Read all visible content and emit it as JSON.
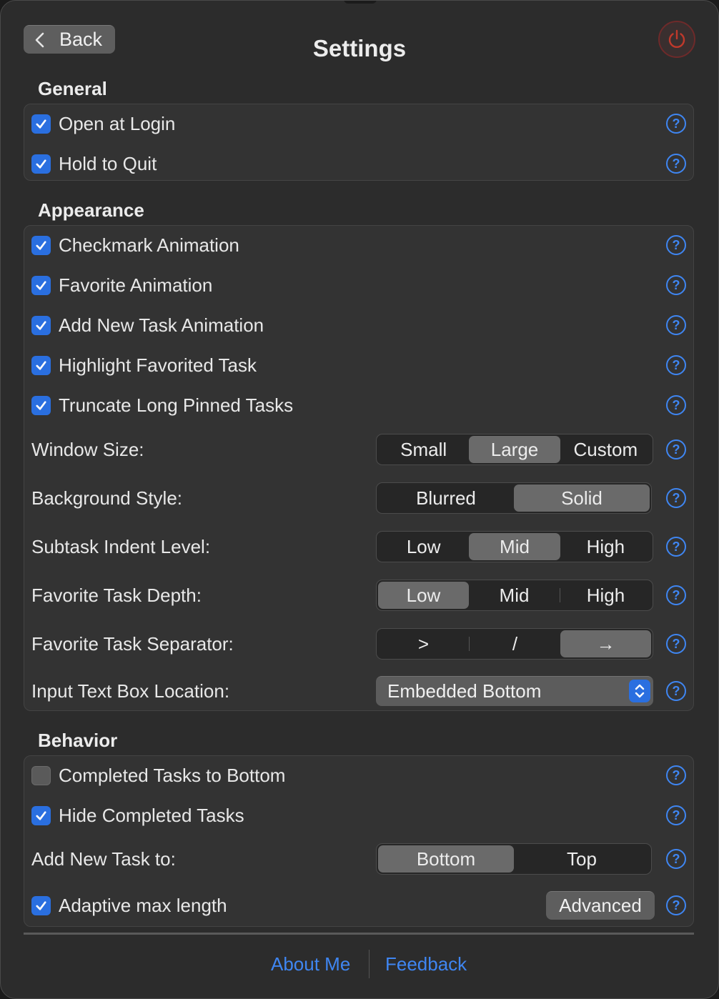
{
  "header": {
    "back_label": "Back",
    "title": "Settings",
    "back_icon": "chevron-left-icon",
    "power_icon": "power-icon",
    "power_color": "#c0392b"
  },
  "general": {
    "heading": "General",
    "items": [
      {
        "label": "Open at Login",
        "checked": true
      },
      {
        "label": "Hold to Quit",
        "checked": true
      }
    ]
  },
  "appearance": {
    "heading": "Appearance",
    "items": [
      {
        "label": "Checkmark Animation",
        "checked": true
      },
      {
        "label": "Favorite Animation",
        "checked": true
      },
      {
        "label": "Add New Task Animation",
        "checked": true
      },
      {
        "label": "Highlight Favorited Task",
        "checked": true
      },
      {
        "label": "Truncate Long Pinned Tasks",
        "checked": true
      }
    ],
    "window_size": {
      "label": "Window Size:",
      "options": [
        "Small",
        "Large",
        "Custom"
      ],
      "selected": "Large"
    },
    "background_style": {
      "label": "Background Style:",
      "options": [
        "Blurred",
        "Solid"
      ],
      "selected": "Solid"
    },
    "subtask_indent": {
      "label": "Subtask Indent Level:",
      "options": [
        "Low",
        "Mid",
        "High"
      ],
      "selected": "Mid"
    },
    "favorite_depth": {
      "label": "Favorite Task Depth:",
      "options": [
        "Low",
        "Mid",
        "High"
      ],
      "selected": "Low"
    },
    "favorite_separator": {
      "label": "Favorite Task Separator:",
      "options": [
        ">",
        "/",
        "→"
      ],
      "selected": "→"
    },
    "input_location": {
      "label": "Input Text Box Location:",
      "value": "Embedded Bottom"
    }
  },
  "behavior": {
    "heading": "Behavior",
    "items": [
      {
        "label": "Completed Tasks to Bottom",
        "checked": false
      },
      {
        "label": "Hide Completed Tasks",
        "checked": true
      }
    ],
    "add_new_task": {
      "label": "Add New Task to:",
      "options": [
        "Bottom",
        "Top"
      ],
      "selected": "Bottom"
    },
    "adaptive": {
      "label": "Adaptive max length",
      "checked": true,
      "button_label": "Advanced"
    }
  },
  "help_glyph": "?",
  "footer": {
    "about": "About Me",
    "feedback": "Feedback"
  },
  "colors": {
    "accent": "#2a6fe0",
    "link": "#3f86f2",
    "background": "#2c2c2c"
  }
}
